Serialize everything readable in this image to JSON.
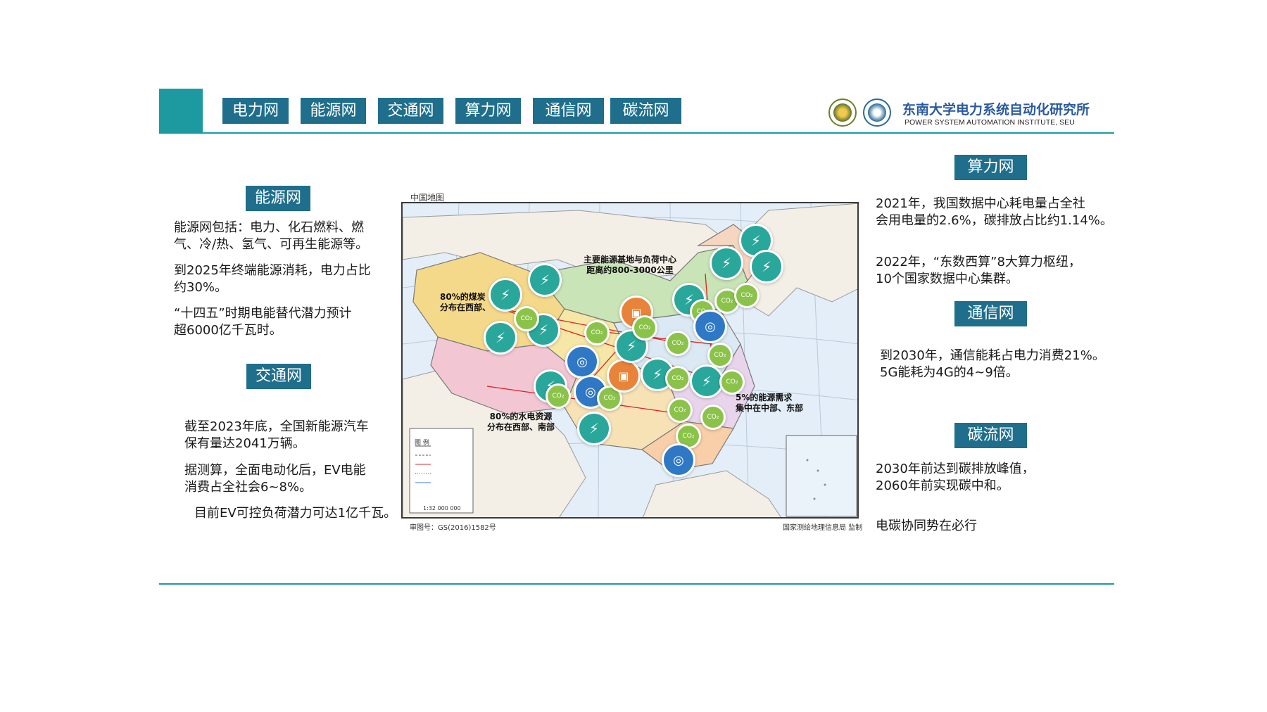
{
  "tabs": [
    "电力网",
    "能源网",
    "交通网",
    "算力网",
    "通信网",
    "碳流网"
  ],
  "institute": {
    "name_cn": "东南大学电力系统自动化研究所",
    "name_en": "POWER SYSTEM AUTOMATION INSTITUTE, SEU"
  },
  "energy": {
    "label": "能源网",
    "p1": "能源网包括：电力、化石燃料、燃\n气、冷/热、氢气、可再生能源等。",
    "p2": "到2025年终端能源消耗，电力占比\n约30%。",
    "p3": "“十四五”时期电能替代潜力预计\n超6000亿千瓦时。"
  },
  "transport": {
    "label": "交通网",
    "p1": "截至2023年底，全国新能源汽车\n保有量达2041万辆。",
    "p2": "据测算，全面电动化后，EV电能\n消费占全社会6~8%。",
    "p3": "目前EV可控负荷潜力可达1亿千瓦。"
  },
  "compute": {
    "label": "算力网",
    "p1": "2021年，我国数据中心耗电量占全社\n会用电量的2.6%，碳排放占比约1.14%。",
    "p2": "2022年，“东数西算”8大算力枢纽，\n10个国家数据中心集群。"
  },
  "comm": {
    "label": "通信网",
    "p1": "到2030年，通信能耗占电力消费21%。\n5G能耗为4G的4~9倍。"
  },
  "carbon": {
    "label": "碳流网",
    "p1": "2030年前达到碳排放峰值，\n2060年前实现碳中和。",
    "p2": "电碳协同势在必行"
  },
  "map": {
    "title": "中国地图",
    "approval": "审图号：GS(2016)1582号",
    "publisher": "国家测绘地理信息局 监制",
    "scale": "1:32 000 000",
    "legend_title": "图  例",
    "note_center": "主要能源基地与负荷中心\n距离约800-3000公里",
    "note_coal": "80%的煤炭\n分布在西部、",
    "note_hydro": "80%的水电资源\n分布在西部、南部",
    "note_demand": "5%的能源需求\n集中在中部、东部",
    "icons": [
      "transmission-tower",
      "co2-cloud",
      "network-globe",
      "electric-car"
    ],
    "colors": {
      "tower": "#2aa79b",
      "co2": "#8bc34a",
      "net": "#2e78c6",
      "car": "#e8843a",
      "highlight": "#e02020"
    }
  }
}
